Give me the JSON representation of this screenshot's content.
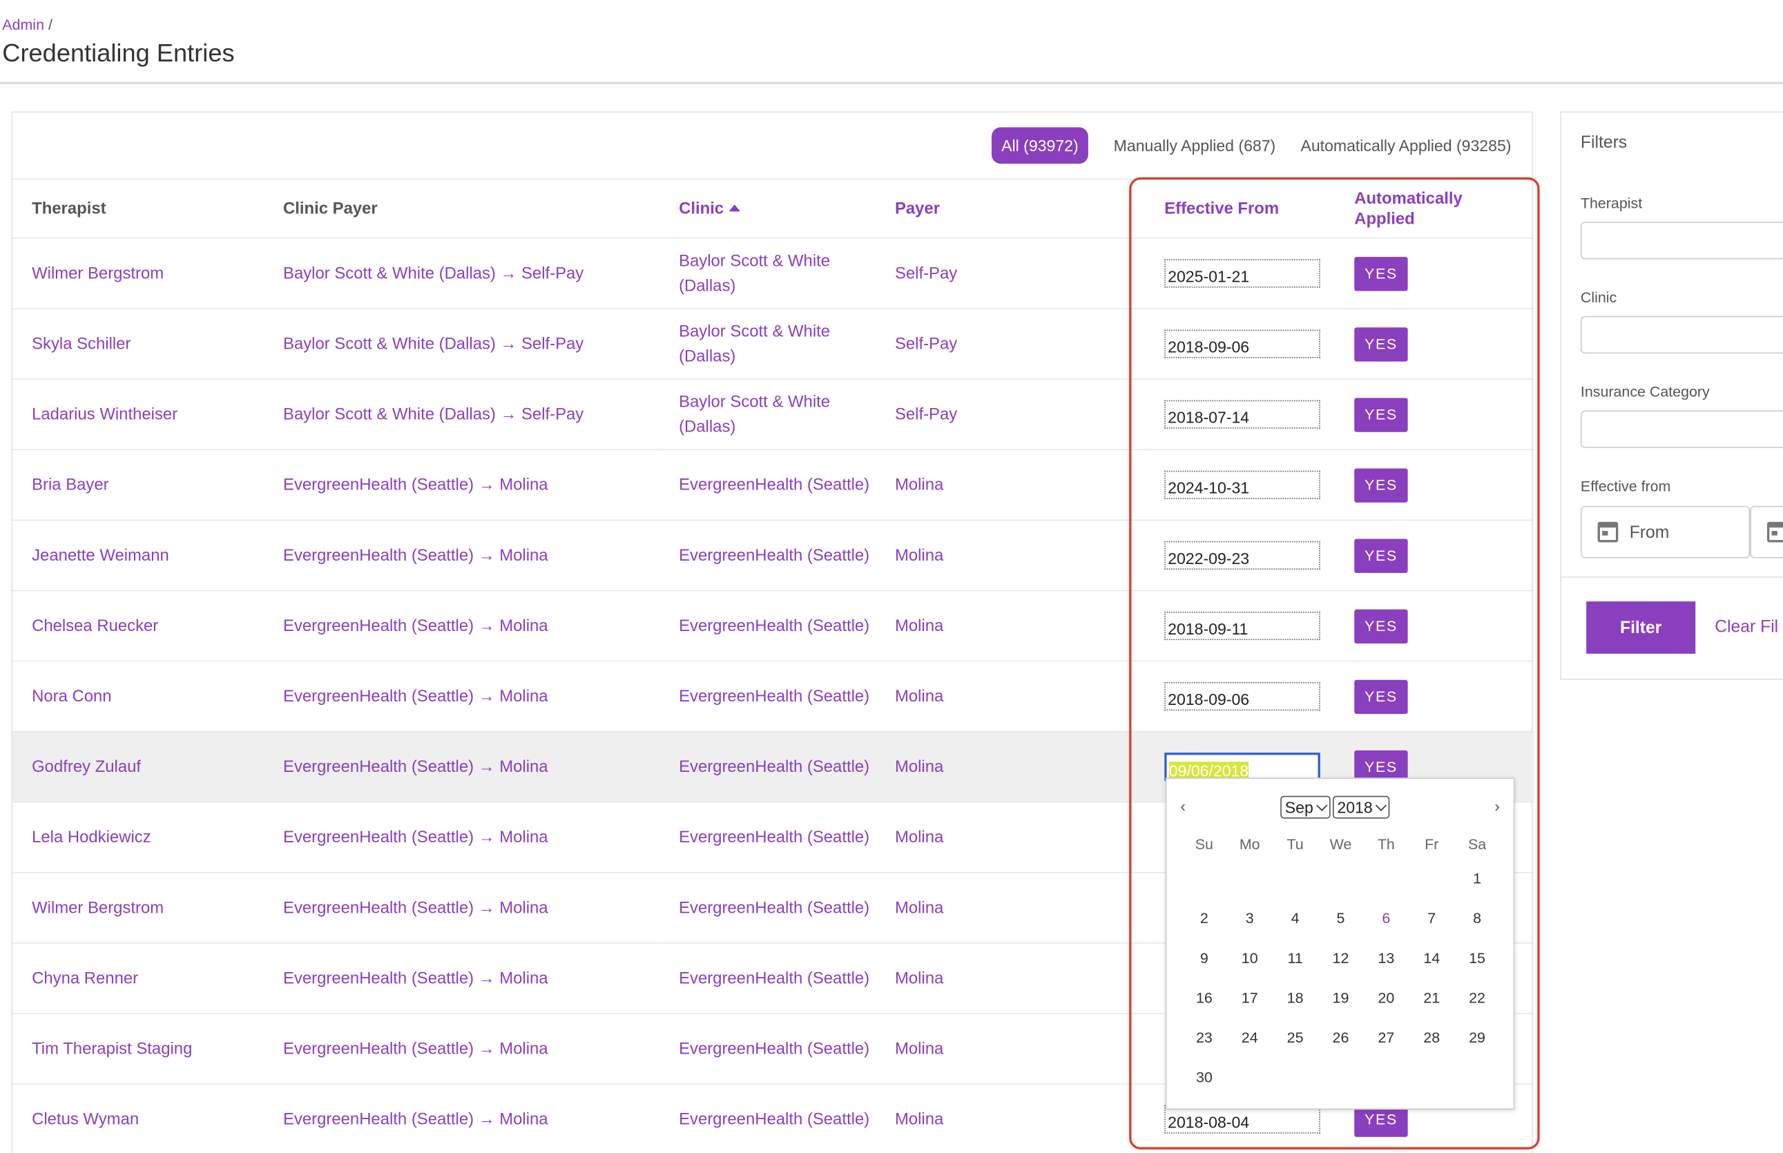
{
  "breadcrumb": {
    "link": "Admin",
    "separator": "/"
  },
  "page_title": "Credentialing Entries",
  "tabs": [
    {
      "label": "All (93972)",
      "active": true
    },
    {
      "label": "Manually Applied (687)",
      "active": false
    },
    {
      "label": "Automatically Applied (93285)",
      "active": false
    }
  ],
  "table": {
    "columns": [
      "Therapist",
      "Clinic Payer",
      "Clinic",
      "Payer",
      "Effective From",
      "Automatically Applied"
    ],
    "sorted_column": "Clinic",
    "sort_direction": "ascending",
    "rows": [
      {
        "therapist": "Wilmer Bergstrom",
        "clinic_payer": "Baylor Scott & White (Dallas) → Self-Pay",
        "clinic": "Baylor Scott & White (Dallas)",
        "payer": "Self-Pay",
        "effective_from": "2025-01-21",
        "auto": "YES"
      },
      {
        "therapist": "Skyla Schiller",
        "clinic_payer": "Baylor Scott & White (Dallas) → Self-Pay",
        "clinic": "Baylor Scott & White (Dallas)",
        "payer": "Self-Pay",
        "effective_from": "2018-09-06",
        "auto": "YES"
      },
      {
        "therapist": "Ladarius Wintheiser",
        "clinic_payer": "Baylor Scott & White (Dallas) → Self-Pay",
        "clinic": "Baylor Scott & White (Dallas)",
        "payer": "Self-Pay",
        "effective_from": "2018-07-14",
        "auto": "YES"
      },
      {
        "therapist": "Bria Bayer",
        "clinic_payer": "EvergreenHealth (Seattle) → Molina",
        "clinic": "EvergreenHealth (Seattle)",
        "payer": "Molina",
        "effective_from": "2024-10-31",
        "auto": "YES"
      },
      {
        "therapist": "Jeanette Weimann",
        "clinic_payer": "EvergreenHealth (Seattle) → Molina",
        "clinic": "EvergreenHealth (Seattle)",
        "payer": "Molina",
        "effective_from": "2022-09-23",
        "auto": "YES"
      },
      {
        "therapist": "Chelsea Ruecker",
        "clinic_payer": "EvergreenHealth (Seattle) → Molina",
        "clinic": "EvergreenHealth (Seattle)",
        "payer": "Molina",
        "effective_from": "2018-09-11",
        "auto": "YES"
      },
      {
        "therapist": "Nora Conn",
        "clinic_payer": "EvergreenHealth (Seattle) → Molina",
        "clinic": "EvergreenHealth (Seattle)",
        "payer": "Molina",
        "effective_from": "2018-09-06",
        "auto": "YES"
      },
      {
        "therapist": "Godfrey Zulauf",
        "clinic_payer": "EvergreenHealth (Seattle) → Molina",
        "clinic": "EvergreenHealth (Seattle)",
        "payer": "Molina",
        "effective_from": "09/06/2018",
        "auto": "YES",
        "editing": true
      },
      {
        "therapist": "Lela Hodkiewicz",
        "clinic_payer": "EvergreenHealth (Seattle) → Molina",
        "clinic": "EvergreenHealth (Seattle)",
        "payer": "Molina",
        "effective_from": "",
        "auto": ""
      },
      {
        "therapist": "Wilmer Bergstrom",
        "clinic_payer": "EvergreenHealth (Seattle) → Molina",
        "clinic": "EvergreenHealth (Seattle)",
        "payer": "Molina",
        "effective_from": "",
        "auto": ""
      },
      {
        "therapist": "Chyna Renner",
        "clinic_payer": "EvergreenHealth (Seattle) → Molina",
        "clinic": "EvergreenHealth (Seattle)",
        "payer": "Molina",
        "effective_from": "",
        "auto": ""
      },
      {
        "therapist": "Tim Therapist Staging",
        "clinic_payer": "EvergreenHealth (Seattle) → Molina",
        "clinic": "EvergreenHealth (Seattle)",
        "payer": "Molina",
        "effective_from": "",
        "auto": ""
      },
      {
        "therapist": "Cletus Wyman",
        "clinic_payer": "EvergreenHealth (Seattle) → Molina",
        "clinic": "EvergreenHealth (Seattle)",
        "payer": "Molina",
        "effective_from": "2018-08-04",
        "auto": "YES"
      }
    ]
  },
  "datepicker": {
    "prev": "‹",
    "next": "›",
    "month": "Sep",
    "year": "2018",
    "weekdays": [
      "Su",
      "Mo",
      "Tu",
      "We",
      "Th",
      "Fr",
      "Sa"
    ],
    "leading_blanks": 6,
    "days": [
      "1",
      "2",
      "3",
      "4",
      "5",
      "6",
      "7",
      "8",
      "9",
      "10",
      "11",
      "12",
      "13",
      "14",
      "15",
      "16",
      "17",
      "18",
      "19",
      "20",
      "21",
      "22",
      "23",
      "24",
      "25",
      "26",
      "27",
      "28",
      "29",
      "30"
    ],
    "selected_day": "6"
  },
  "filters": {
    "title": "Filters",
    "therapist_label": "Therapist",
    "clinic_label": "Clinic",
    "insurance_label": "Insurance Category",
    "effective_label": "Effective from",
    "from_placeholder": "From",
    "filter_button": "Filter",
    "clear_link": "Clear Fil"
  },
  "colors": {
    "accent": "#8a3fbf",
    "highlight_box": "#e03a2c",
    "row_highlight": "#efefef"
  }
}
